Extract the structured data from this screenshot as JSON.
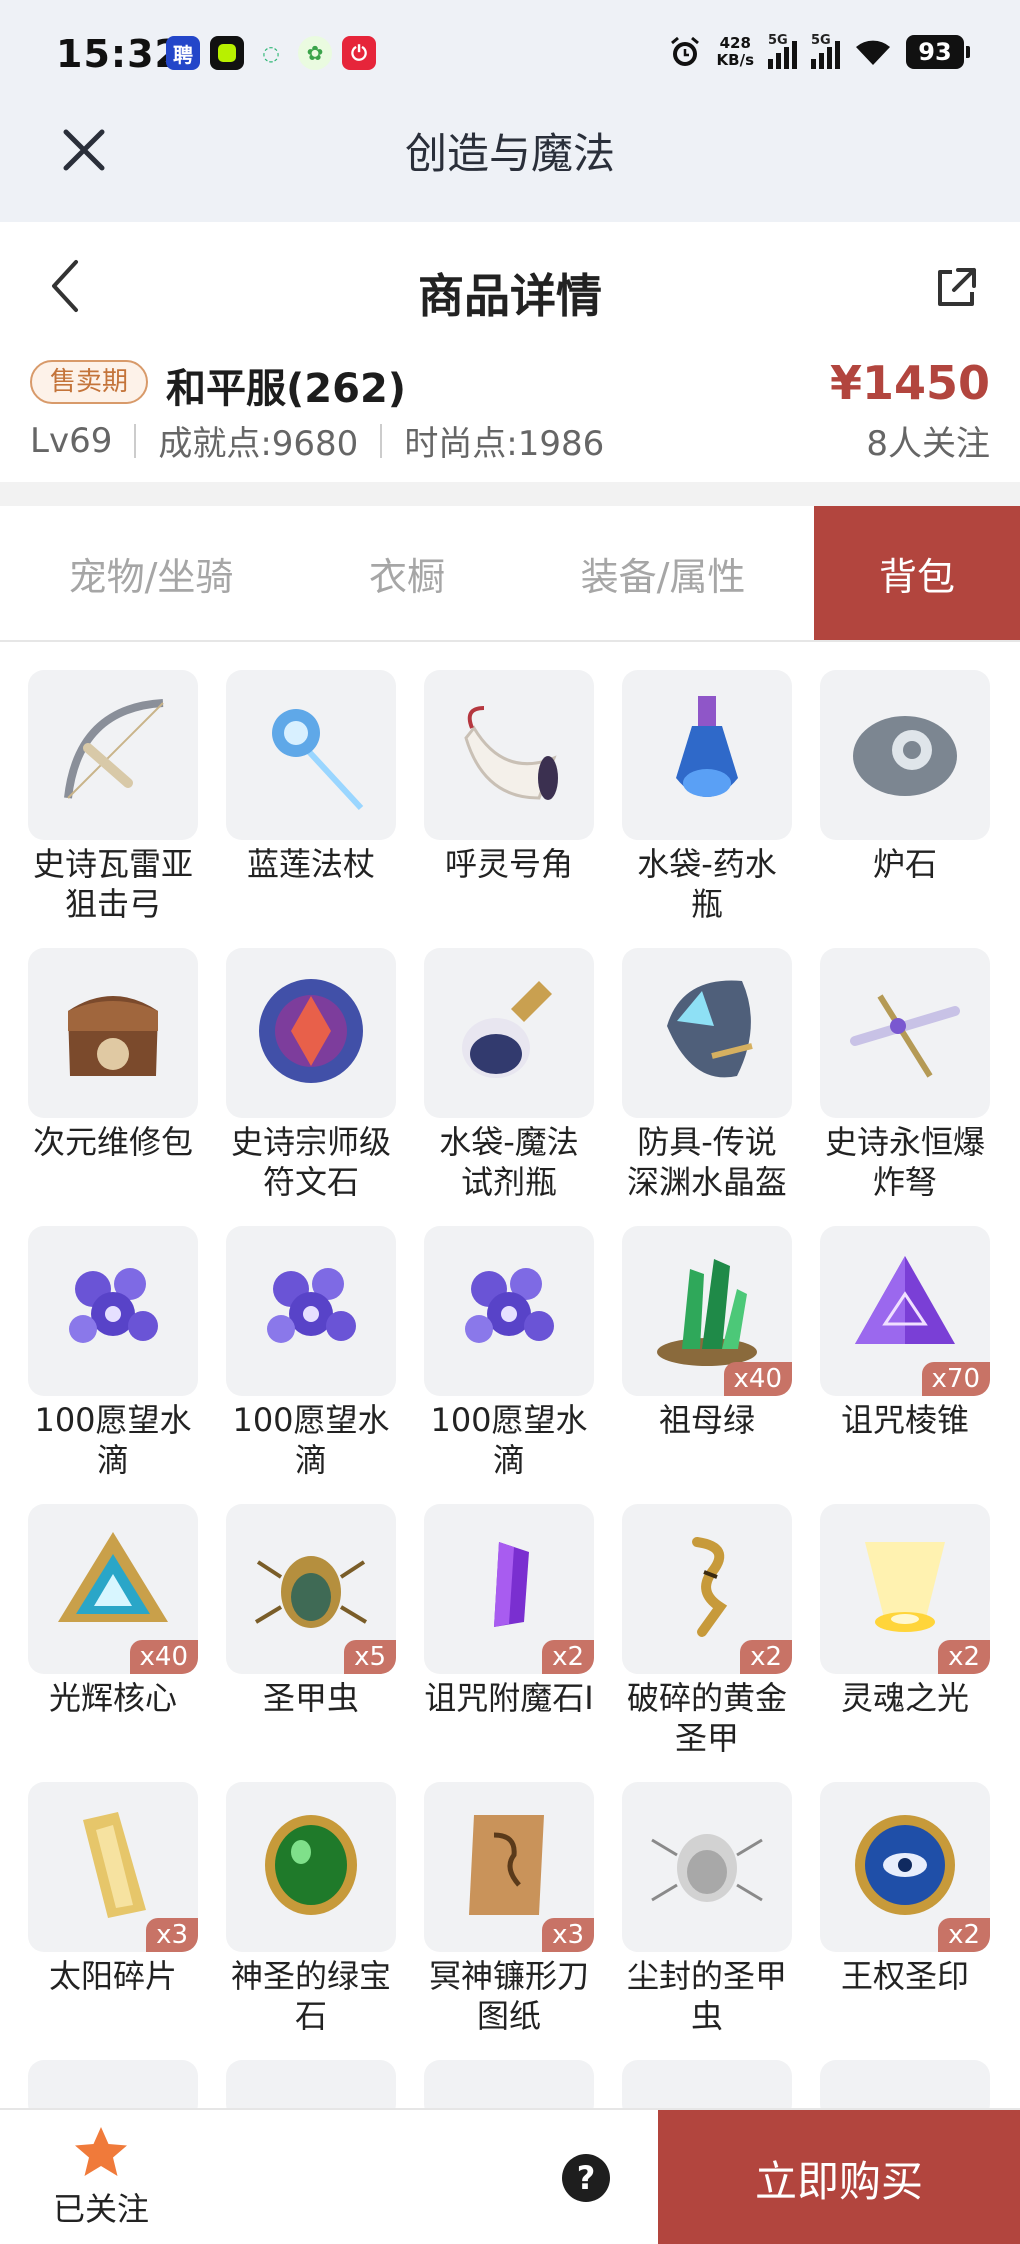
{
  "status_bar": {
    "time": "15:32",
    "net_speed_value": "428",
    "net_speed_unit": "KB/s",
    "signal1_label": "5G",
    "signal2_label": "5G",
    "battery": "93"
  },
  "app_header": {
    "title": "创造与魔法"
  },
  "detail": {
    "title": "商品详情",
    "sale_badge": "售卖期",
    "server": "和平服(262)",
    "price": "¥1450",
    "level": "Lv69",
    "achievement": "成就点:9680",
    "fashion": "时尚点:1986",
    "followers": "8人关注"
  },
  "tabs": [
    {
      "label": "宠物/坐骑",
      "active": false
    },
    {
      "label": "衣橱",
      "active": false
    },
    {
      "label": "装备/属性",
      "active": false
    },
    {
      "label": "背包",
      "active": true
    }
  ],
  "items": [
    {
      "name": "史诗瓦雷亚狙击弓",
      "icon": "bow-icon",
      "qty": ""
    },
    {
      "name": "蓝莲法杖",
      "icon": "staff-icon",
      "qty": ""
    },
    {
      "name": "呼灵号角",
      "icon": "horn-icon",
      "qty": ""
    },
    {
      "name": "水袋-药水瓶",
      "icon": "potion-bottle-icon",
      "qty": ""
    },
    {
      "name": "炉石",
      "icon": "hearthstone-icon",
      "qty": ""
    },
    {
      "name": "次元维修包",
      "icon": "repair-bag-icon",
      "qty": ""
    },
    {
      "name": "史诗宗师级符文石",
      "icon": "rune-stone-icon",
      "qty": ""
    },
    {
      "name": "水袋-魔法试剂瓶",
      "icon": "magic-flask-icon",
      "qty": ""
    },
    {
      "name": "防具-传说深渊水晶盔",
      "icon": "crystal-helmet-icon",
      "qty": ""
    },
    {
      "name": "史诗永恒爆炸弩",
      "icon": "crossbow-icon",
      "qty": ""
    },
    {
      "name": "100愿望水滴",
      "icon": "wish-drop-icon",
      "qty": ""
    },
    {
      "name": "100愿望水滴",
      "icon": "wish-drop-icon",
      "qty": ""
    },
    {
      "name": "100愿望水滴",
      "icon": "wish-drop-icon",
      "qty": ""
    },
    {
      "name": "祖母绿",
      "icon": "emerald-icon",
      "qty": "x40"
    },
    {
      "name": "诅咒棱锥",
      "icon": "cursed-pyramid-icon",
      "qty": "x70"
    },
    {
      "name": "光辉核心",
      "icon": "radiant-core-icon",
      "qty": "x40"
    },
    {
      "name": "圣甲虫",
      "icon": "scarab-icon",
      "qty": "x5"
    },
    {
      "name": "诅咒附魔石Ⅰ",
      "icon": "enchant-stone-icon",
      "qty": "x2"
    },
    {
      "name": "破碎的黄金圣甲",
      "icon": "broken-gold-armor-icon",
      "qty": "x2"
    },
    {
      "name": "灵魂之光",
      "icon": "soul-light-icon",
      "qty": "x2"
    },
    {
      "name": "太阳碎片",
      "icon": "sun-shard-icon",
      "qty": "x3"
    },
    {
      "name": "神圣的绿宝石",
      "icon": "holy-gem-icon",
      "qty": ""
    },
    {
      "name": "冥神镰形刀图纸",
      "icon": "blueprint-icon",
      "qty": "x3"
    },
    {
      "name": "尘封的圣甲虫",
      "icon": "dusty-scarab-icon",
      "qty": ""
    },
    {
      "name": "王权圣印",
      "icon": "royal-seal-icon",
      "qty": "x2"
    }
  ],
  "bottom": {
    "follow_label": "已关注",
    "help_symbol": "?",
    "buy_label": "立即购买"
  },
  "colors": {
    "accent": "#b2453e",
    "badge": "#c4743a",
    "qty_badge": "#c87366"
  }
}
